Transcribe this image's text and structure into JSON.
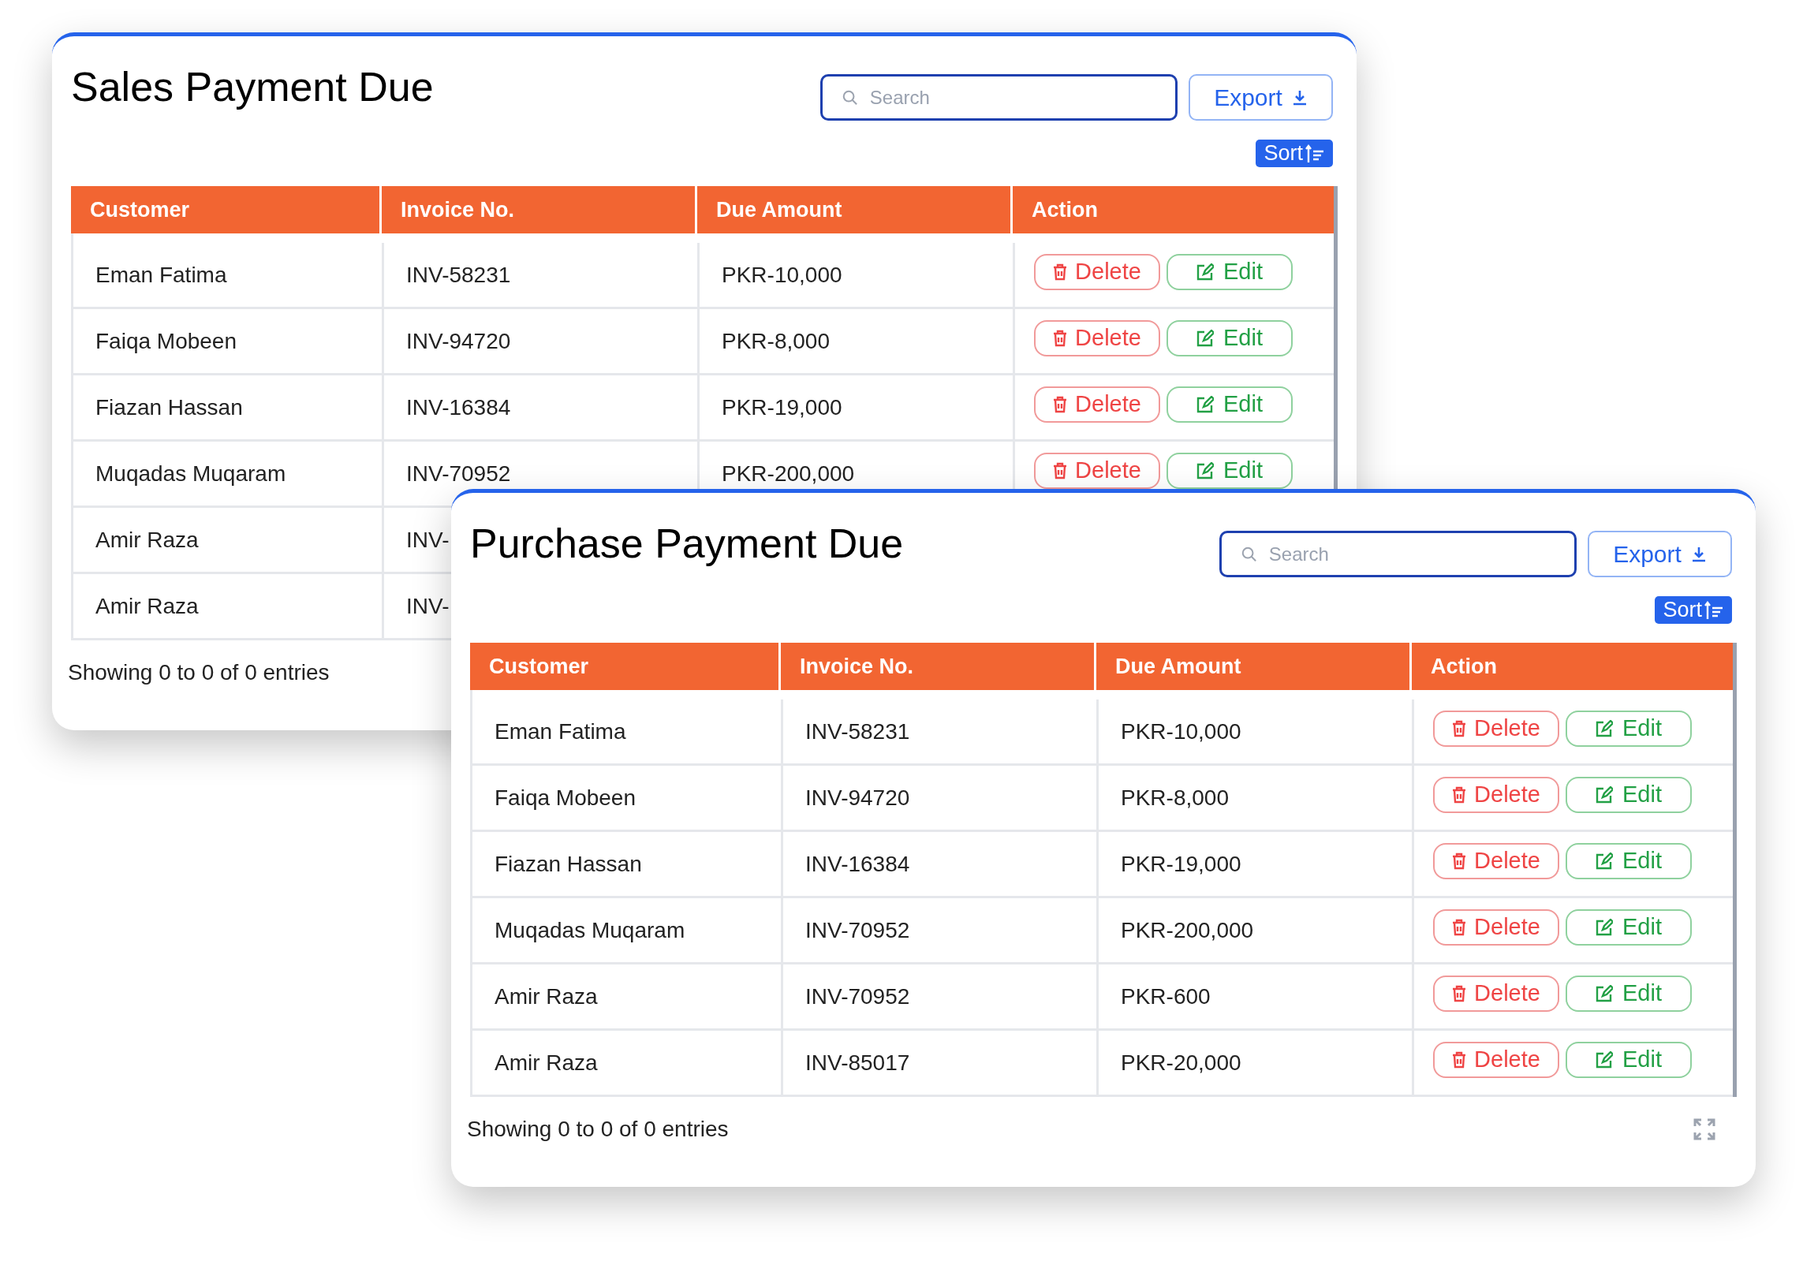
{
  "panels": [
    {
      "title": "Sales Payment Due",
      "search": {
        "placeholder": "Search"
      },
      "export_button": "Export",
      "sort_button": "Sort",
      "columns": [
        "Customer",
        "Invoice No.",
        "Due Amount",
        "Action"
      ],
      "rows": [
        {
          "customer": "Eman Fatima",
          "invoice_no": "INV-58231",
          "due_amount": "PKR-10,000",
          "actions": [
            "Delete",
            "Edit"
          ]
        },
        {
          "customer": "Faiqa Mobeen",
          "invoice_no": "INV-94720",
          "due_amount": "PKR-8,000",
          "actions": [
            "Delete",
            "Edit"
          ]
        },
        {
          "customer": "Fiazan Hassan",
          "invoice_no": "INV-16384",
          "due_amount": "PKR-19,000",
          "actions": [
            "Delete",
            "Edit"
          ]
        },
        {
          "customer": "Muqadas Muqaram",
          "invoice_no": "INV-70952",
          "due_amount": "PKR-200,000",
          "actions": [
            "Delete",
            "Edit"
          ]
        },
        {
          "customer": "Amir Raza",
          "invoice_no": "INV-"
        },
        {
          "customer": "Amir Raza",
          "invoice_no": "INV-"
        }
      ],
      "footer": "Showing 0 to 0 of 0 entries"
    },
    {
      "title": "Purchase Payment Due",
      "search": {
        "placeholder": "Search"
      },
      "export_button": "Export",
      "sort_button": "Sort",
      "columns": [
        "Customer",
        "Invoice No.",
        "Due Amount",
        "Action"
      ],
      "rows": [
        {
          "customer": "Eman Fatima",
          "invoice_no": "INV-58231",
          "due_amount": "PKR-10,000",
          "actions": [
            "Delete",
            "Edit"
          ]
        },
        {
          "customer": "Faiqa Mobeen",
          "invoice_no": "INV-94720",
          "due_amount": "PKR-8,000",
          "actions": [
            "Delete",
            "Edit"
          ]
        },
        {
          "customer": "Fiazan Hassan",
          "invoice_no": "INV-16384",
          "due_amount": "PKR-19,000",
          "actions": [
            "Delete",
            "Edit"
          ]
        },
        {
          "customer": "Muqadas Muqaram",
          "invoice_no": "INV-70952",
          "due_amount": "PKR-200,000",
          "actions": [
            "Delete",
            "Edit"
          ]
        },
        {
          "customer": "Amir Raza",
          "invoice_no": "INV-70952",
          "due_amount": "PKR-600",
          "actions": [
            "Delete",
            "Edit"
          ]
        },
        {
          "customer": "Amir Raza",
          "invoice_no": "INV-85017",
          "due_amount": "PKR-20,000",
          "actions": [
            "Delete",
            "Edit"
          ]
        }
      ],
      "footer": "Showing 0 to 0 of 0 entries",
      "fullscreen_button": true
    }
  ]
}
